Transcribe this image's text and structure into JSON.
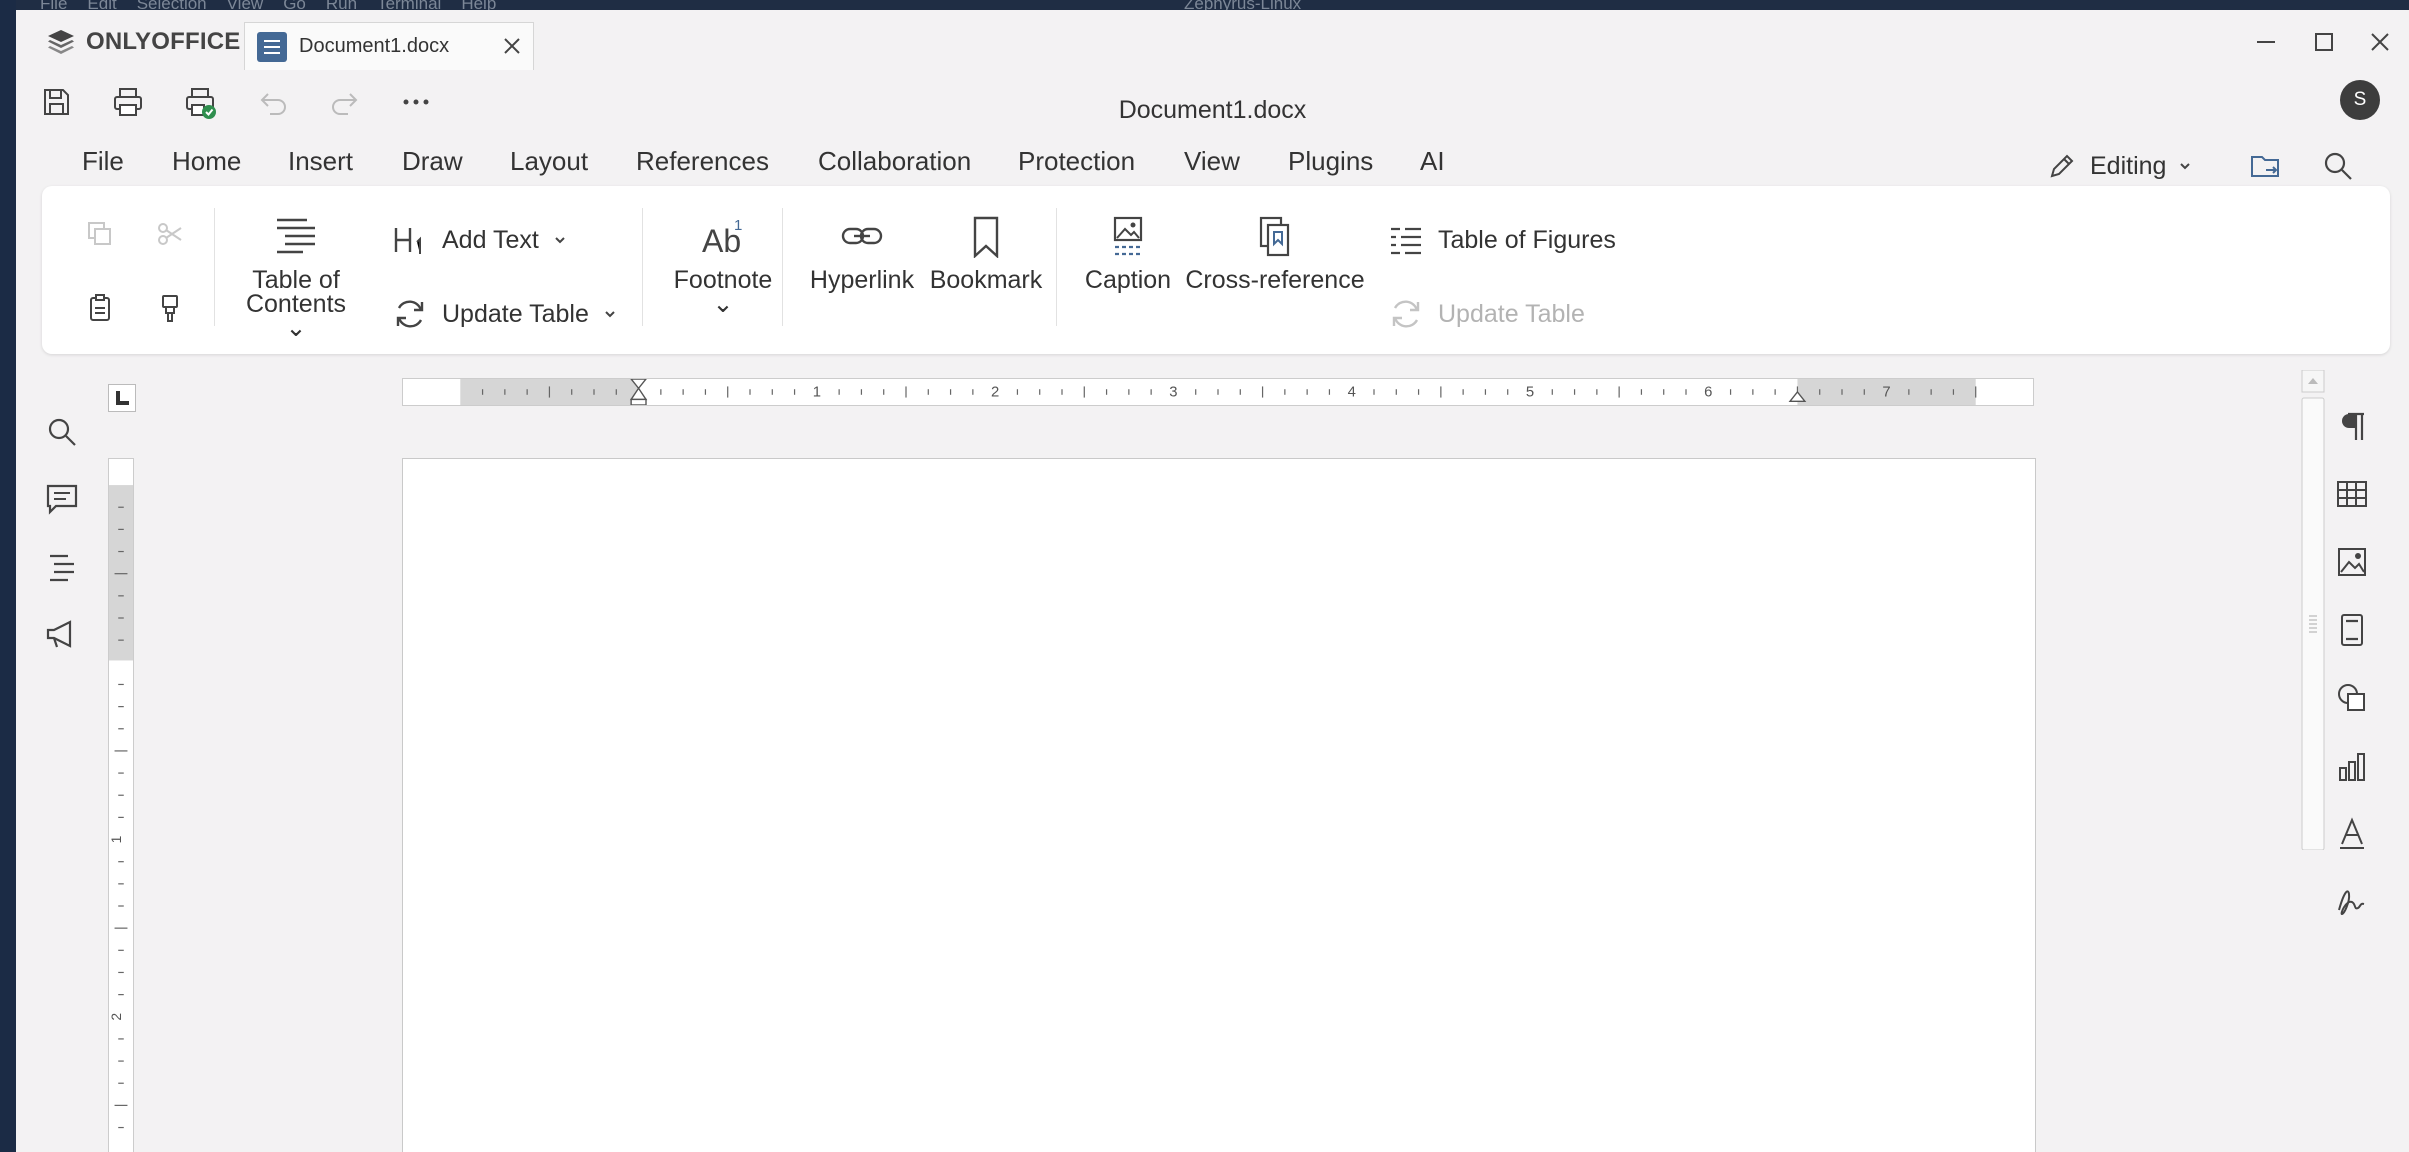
{
  "background_app": {
    "menu": [
      "File",
      "Edit",
      "Selection",
      "View",
      "Go",
      "Run",
      "Terminal",
      "Help"
    ],
    "title": "Zephyrus-Linux"
  },
  "app": {
    "brand": "ONLYOFFICE",
    "doc_tab": "Document1.docx",
    "doc_title": "Document1.docx",
    "avatar_initial": "S"
  },
  "menu_tabs": [
    "File",
    "Home",
    "Insert",
    "Draw",
    "Layout",
    "References",
    "Collaboration",
    "Protection",
    "View",
    "Plugins",
    "AI"
  ],
  "active_tab": "References",
  "editing_mode": "Editing",
  "ribbon": {
    "toc_line1": "Table of",
    "toc_line2": "Contents",
    "add_text": "Add Text",
    "update_table": "Update Table",
    "footnote": "Footnote",
    "hyperlink": "Hyperlink",
    "bookmark": "Bookmark",
    "caption": "Caption",
    "cross_reference": "Cross-reference",
    "table_of_figures": "Table of Figures",
    "update_table_figures": "Update Table"
  },
  "ruler": {
    "h_labels": [
      "1",
      "2",
      "3",
      "4",
      "5",
      "6",
      "7"
    ],
    "v_labels": [
      "1",
      "2"
    ]
  },
  "colors": {
    "accent": "#446995",
    "print_badge": "#2f8f4e"
  }
}
